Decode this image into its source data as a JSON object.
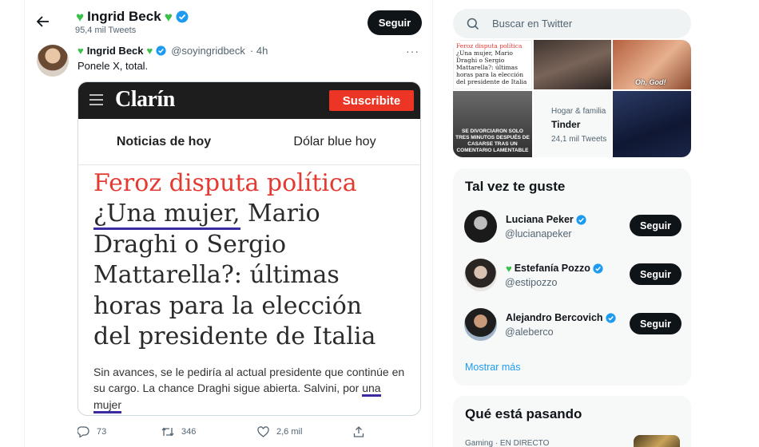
{
  "header": {
    "name": "Ingrid Beck",
    "tweet_count": "95,4 mil Tweets",
    "follow_label": "Seguir"
  },
  "tweet": {
    "author_name": "Ingrid Beck",
    "handle": "@soyingridbeck",
    "time": "· 4h",
    "text": "Ponele X, total.",
    "more": "···",
    "actions": {
      "replies": "73",
      "retweets": "346",
      "likes": "2,6 mil"
    }
  },
  "embed": {
    "logo": "Clarín",
    "subscribe": "Suscribite",
    "tabs": [
      "Noticias de hoy",
      "Dólar blue hoy"
    ],
    "kicker": "Feroz disputa política",
    "title_underlined": "¿Una mujer,",
    "title_rest": " Mario Draghi o Sergio Mattarella?: últimas horas para la elección del presidente de Italia",
    "summary": "Sin avances, se le pediría al actual presidente que continúe en su cargo. La chance Draghi sigue abierta. Salvini, por ",
    "summary_underlined": "una mujer"
  },
  "search": {
    "placeholder": "Buscar en Twitter"
  },
  "media_grid": {
    "thumb1_kicker": "Feroz disputa política",
    "thumb1_text": "¿Una mujer, Mario Draghi o Sergio Mattarella?: últimas horas para la elección del presidente de Italia",
    "thumb3_caption": "Oh, God!",
    "thumb4_caption": "Se divorciaron solo tres minutos después de casarse tras un comentario lamentable",
    "topic_category": "Hogar & familia",
    "topic_title": "Tinder",
    "topic_count": "24,1 mil Tweets"
  },
  "who_to_follow": {
    "title": "Tal vez te guste",
    "follow_label": "Seguir",
    "show_more": "Mostrar más",
    "users": [
      {
        "name": "Luciana Peker",
        "handle": "@lucianapeker",
        "heart": false
      },
      {
        "name": "Estefanía Pozzo",
        "handle": "@estipozzo",
        "heart": true
      },
      {
        "name": "Alejandro Bercovich",
        "handle": "@aleberco",
        "heart": false
      }
    ]
  },
  "happening": {
    "title": "Qué está pasando",
    "meta": "Gaming · EN DIRECTO"
  },
  "colors": {
    "verified": "#1d9bf0",
    "heart": "#3bbf4b",
    "clarin_red": "#e43a31",
    "underline": "#3a2ba1"
  }
}
